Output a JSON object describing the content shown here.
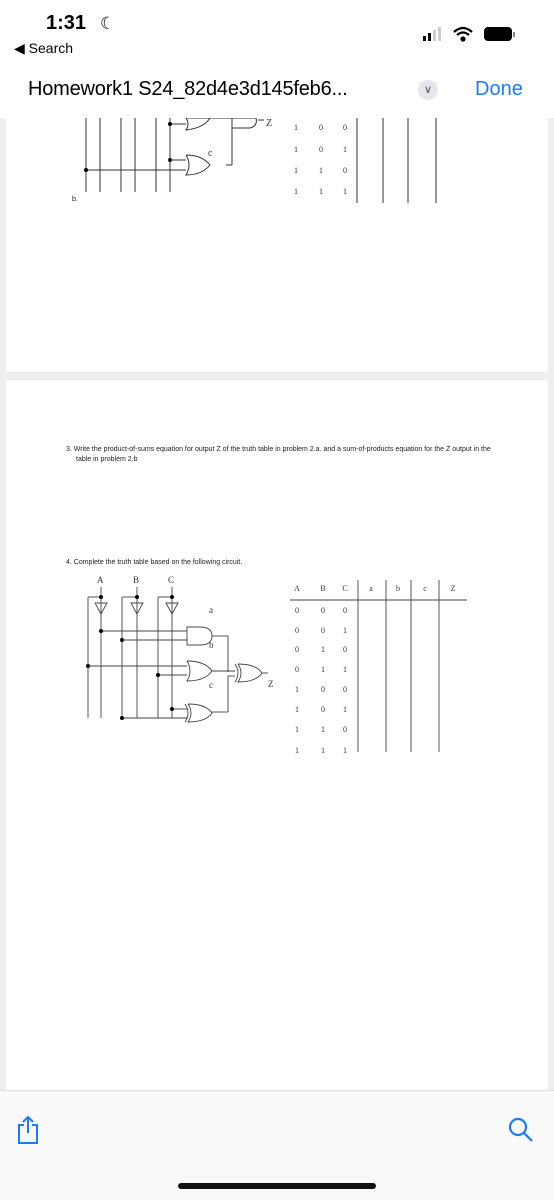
{
  "status": {
    "time": "1:31",
    "back_label": "Search"
  },
  "nav": {
    "title": "Homework1 S24_82d4e3d145feb6...",
    "done": "Done"
  },
  "page1": {
    "part_label": "b.",
    "gate_labels": [
      "Z",
      "c"
    ],
    "rows": [
      [
        "1",
        "0",
        "0"
      ],
      [
        "1",
        "0",
        "1"
      ],
      [
        "1",
        "1",
        "0"
      ],
      [
        "1",
        "1",
        "1"
      ]
    ]
  },
  "page2": {
    "q3": "3.  Write the product-of-sums equation for output Z of the truth table in problem 2.a. and a sum-of-products equation for the Z output in the table in problem 2.b",
    "q4": "4.  Complete the truth table based on the following circuit.",
    "inputs": [
      "A",
      "B",
      "C"
    ],
    "gate_labels": [
      "a",
      "b",
      "c",
      "Z"
    ],
    "headers": [
      "A",
      "B",
      "C",
      "a",
      "b",
      "c",
      "Z"
    ],
    "rows": [
      [
        "0",
        "0",
        "0"
      ],
      [
        "0",
        "0",
        "1"
      ],
      [
        "0",
        "1",
        "0"
      ],
      [
        "0",
        "1",
        "1"
      ],
      [
        "1",
        "0",
        "0"
      ],
      [
        "1",
        "0",
        "1"
      ],
      [
        "1",
        "1",
        "0"
      ],
      [
        "1",
        "1",
        "1"
      ]
    ]
  },
  "icons": {
    "share": "share-icon",
    "search": "search-icon",
    "chevron": "chevron-down-icon"
  }
}
